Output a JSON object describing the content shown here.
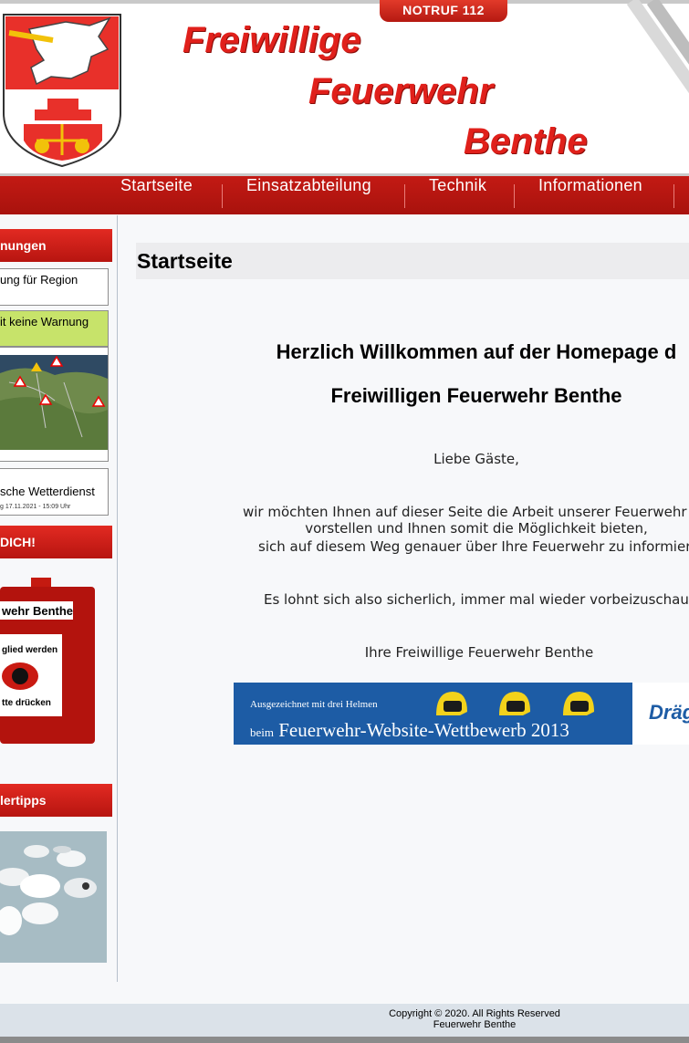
{
  "header": {
    "notruf": "NOTRUF 112",
    "title_line1": "Freiwillige",
    "title_line2": "Feuerwehr",
    "title_line3": "Benthe"
  },
  "nav": {
    "items": [
      "Startseite",
      "Einsatzabteilung",
      "Technik",
      "Informationen"
    ]
  },
  "sidebar": {
    "warnings_head": "nungen",
    "region_text": "ung für Region",
    "no_warning": "it keine Warnung",
    "dwd_name": "sche Wetterdienst",
    "dwd_date": "g 17.11.2021 - 15:09 Uhr",
    "join_head": "DICH!",
    "alarm_brand": "wehr Benthe",
    "alarm_member": "glied werden",
    "alarm_press": "tte drücken",
    "tips_head": "lertipps"
  },
  "main": {
    "page_title": "Startseite",
    "welcome_line1": "Herzlich Willkommen auf der Homepage d",
    "welcome_line2": "Freiwilligen Feuerwehr Benthe",
    "greeting": "Liebe Gäste,",
    "intro_line1": "wir möchten Ihnen auf dieser Seite die Arbeit unserer Feuerwehr nä",
    "intro_line2": "vorstellen und Ihnen somit die Möglichkeit bieten,",
    "intro_line3": "sich auf diesem Weg  genauer über Ihre Feuerwehr zu informieren",
    "closing": "Es lohnt sich also sicherlich, immer mal wieder vorbeizuschauen.",
    "signature": "Ihre Freiwillige Feuerwehr Benthe",
    "award_small": "Ausgezeichnet mit drei Helmen",
    "award_prefix": "beim",
    "award_big": "Feuerwehr-Website-Wettbewerb 2013",
    "award_sponsor": "Dräg"
  },
  "footer": {
    "copyright": "Copyright © 2020. All Rights Reserved",
    "org": "Feuerwehr Benthe"
  },
  "colors": {
    "brand_red": "#c31a14",
    "award_blue": "#1d5ca5",
    "warning_green": "#c7e36a"
  }
}
